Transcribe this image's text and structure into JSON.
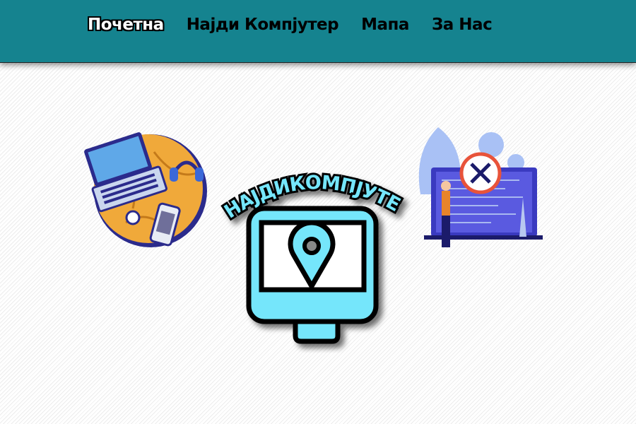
{
  "nav": {
    "items": [
      {
        "label": "Почетна",
        "active": true
      },
      {
        "label": "Најди Компјутер",
        "active": false
      },
      {
        "label": "Мапа",
        "active": false
      },
      {
        "label": "За Нас",
        "active": false
      }
    ]
  },
  "logo": {
    "text": "НАЈДИКОМПЈУТЕР"
  },
  "colors": {
    "header": "#15838f",
    "logo_fill": "#75e6fb"
  }
}
